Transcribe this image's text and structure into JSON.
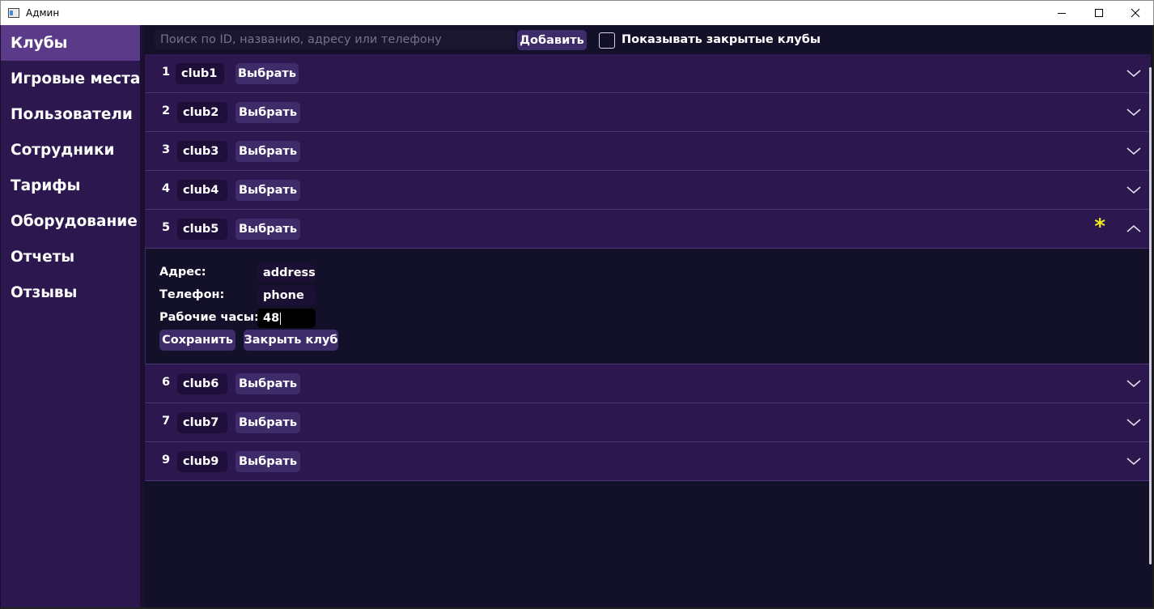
{
  "window": {
    "title": "Админ"
  },
  "sidebar": {
    "items": [
      {
        "label": "Клубы",
        "active": true
      },
      {
        "label": "Игровые места"
      },
      {
        "label": "Пользователи"
      },
      {
        "label": "Сотрудники"
      },
      {
        "label": "Тарифы"
      },
      {
        "label": "Оборудование"
      },
      {
        "label": "Отчеты"
      },
      {
        "label": "Отзывы"
      }
    ]
  },
  "toolbar": {
    "search_placeholder": "Поиск по ID, названию, адресу или телефону",
    "search_value": "",
    "add_label": "Добавить",
    "show_closed_label": "Показывать закрытые клубы",
    "show_closed_checked": false
  },
  "clubs": [
    {
      "id": "1",
      "name": "club1",
      "select_label": "Выбрать",
      "expanded": false
    },
    {
      "id": "2",
      "name": "club2",
      "select_label": "Выбрать",
      "expanded": false
    },
    {
      "id": "3",
      "name": "club3",
      "select_label": "Выбрать",
      "expanded": false
    },
    {
      "id": "4",
      "name": "club4",
      "select_label": "Выбрать",
      "expanded": false
    },
    {
      "id": "5",
      "name": "club5",
      "select_label": "Выбрать",
      "expanded": true,
      "modified_marker": "*"
    },
    {
      "id": "6",
      "name": "club6",
      "select_label": "Выбрать",
      "expanded": false
    },
    {
      "id": "7",
      "name": "club7",
      "select_label": "Выбрать",
      "expanded": false
    },
    {
      "id": "9",
      "name": "club9",
      "select_label": "Выбрать",
      "expanded": false
    }
  ],
  "details": {
    "address_label": "Адрес:",
    "address_value": "address",
    "phone_label": "Телефон:",
    "phone_value": "phone",
    "hours_label": "Рабочие часы:",
    "hours_value": "48",
    "save_label": "Сохранить",
    "close_club_label": "Закрыть клуб"
  },
  "colors": {
    "sidebar_bg": "#2d174f",
    "sidebar_active": "#5b3a8a",
    "row_bg": "#2d174f",
    "page_bg": "#13112a",
    "button_bg": "#3e2c6a",
    "modified_marker": "#f1e81d"
  }
}
